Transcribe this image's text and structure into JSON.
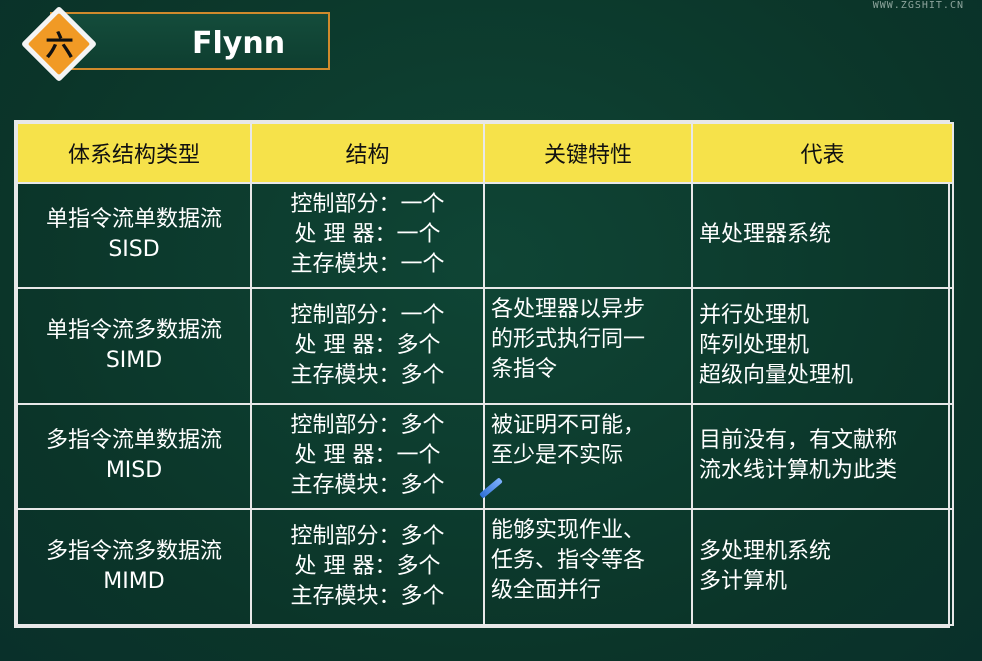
{
  "watermark": "WWW.ZGSHIT.CN",
  "header": {
    "number": "六",
    "title": "Flynn"
  },
  "colors": {
    "background": "#0c3a2e",
    "header_row": "#f6e24a",
    "accent_orange": "#f19a25",
    "border": "#e8e8e8"
  },
  "table": {
    "headers": [
      "体系结构类型",
      "结构",
      "关键特性",
      "代表"
    ],
    "rows": [
      {
        "type": [
          "单指令流单数据流",
          "SISD"
        ],
        "structure": [
          "控制部分：一个",
          "处 理 器：一个",
          "主存模块：一个"
        ],
        "features": [],
        "representatives": [
          "单处理器系统"
        ]
      },
      {
        "type": [
          "单指令流多数据流",
          "SIMD"
        ],
        "structure": [
          "控制部分：一个",
          "处 理 器：多个",
          "主存模块：多个"
        ],
        "features": [
          "各处理器以异步",
          "的形式执行同一",
          "条指令"
        ],
        "representatives": [
          "并行处理机",
          "阵列处理机",
          "超级向量处理机"
        ]
      },
      {
        "type": [
          "多指令流单数据流",
          "MISD"
        ],
        "structure": [
          "控制部分：多个",
          "处 理 器：一个",
          "主存模块：多个"
        ],
        "features": [
          "被证明不可能，",
          "至少是不实际"
        ],
        "representatives": [
          "目前没有，有文献称",
          "流水线计算机为此类"
        ]
      },
      {
        "type": [
          "多指令流多数据流",
          "MIMD"
        ],
        "structure": [
          "控制部分：多个",
          "处 理 器：多个",
          "主存模块：多个"
        ],
        "features": [
          "能够实现作业、",
          "任务、指令等各",
          "级全面并行"
        ],
        "representatives": [
          "多处理机系统",
          "多计算机"
        ]
      }
    ]
  }
}
